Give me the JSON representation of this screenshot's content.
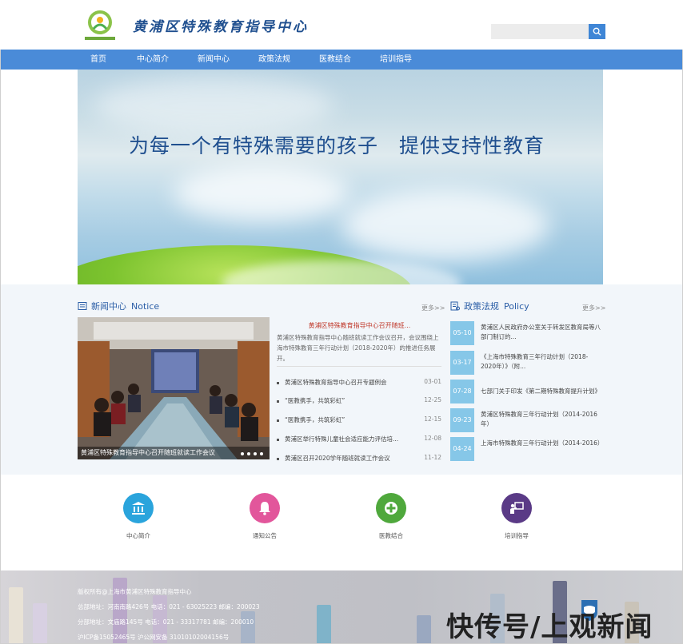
{
  "header": {
    "site_title": "黄浦区特殊教育指导中心",
    "search_placeholder": ""
  },
  "nav": [
    "首页",
    "中心简介",
    "新闻中心",
    "政策法规",
    "医教结合",
    "培训指导"
  ],
  "banner": {
    "slogan": "为每一个有特殊需要的孩子　提供支持性教育"
  },
  "news": {
    "title_cn": "新闻中心",
    "title_en": "Notice",
    "more": "更多>>",
    "photo_caption": "黄浦区特殊教育指导中心召开随班就读工作会议",
    "headline": "黄浦区特殊教育指导中心召开随班...",
    "lead": "黄浦区特殊教育指导中心随班就读工作会议召开，会议围绕上海市特殊教育三年行动计划（2018-2020年）的推进任务展开。",
    "items": [
      {
        "title": "黄浦区特殊教育指导中心召开专题例会",
        "date": "03-01"
      },
      {
        "title": "“医教携手，共筑彩虹”",
        "date": "12-25"
      },
      {
        "title": "“医教携手，共筑彩虹”",
        "date": "12-15"
      },
      {
        "title": "黄浦区举行特殊儿童社会适应能力评估培...",
        "date": "12-08"
      },
      {
        "title": "黄浦区召开2020学年随班就读工作会议",
        "date": "11-12"
      }
    ]
  },
  "policy": {
    "title_cn": "政策法规",
    "title_en": "Policy",
    "more": "更多>>",
    "items": [
      {
        "date": "05-10",
        "title": "黄浦区人民政府办公室关于转发区教育局等八部门制订的..."
      },
      {
        "date": "03-17",
        "title": "《上海市特殊教育三年行动计划（2018-2020年）》（附..."
      },
      {
        "date": "07-28",
        "title": "七部门关于印发《第二期特殊教育提升计划》"
      },
      {
        "date": "09-23",
        "title": "黄浦区特殊教育三年行动计划（2014-2016年）"
      },
      {
        "date": "04-24",
        "title": "上海市特殊教育三年行动计划（2014-2016）"
      }
    ]
  },
  "quick_links": [
    {
      "label": "中心简介",
      "icon": "building-icon",
      "color": "#2aa4dc"
    },
    {
      "label": "通知公告",
      "icon": "bell-icon",
      "color": "#e2569b"
    },
    {
      "label": "医教结合",
      "icon": "plus-icon",
      "color": "#4fa83c"
    },
    {
      "label": "培训指导",
      "icon": "teacher-icon",
      "color": "#5a3a86"
    }
  ],
  "footer": {
    "lines": [
      "版权所有@上海市黄浦区特殊教育指导中心",
      "总部地址：河南南路426号 电话：021 - 63025223 邮编：200023",
      "分部地址：文庙路145号 电话：021 - 33317781 邮编：200010",
      "沪ICP备15052465号 沪公网安备 31010102004156号"
    ]
  },
  "watermark": "快传号/上观新闻"
}
